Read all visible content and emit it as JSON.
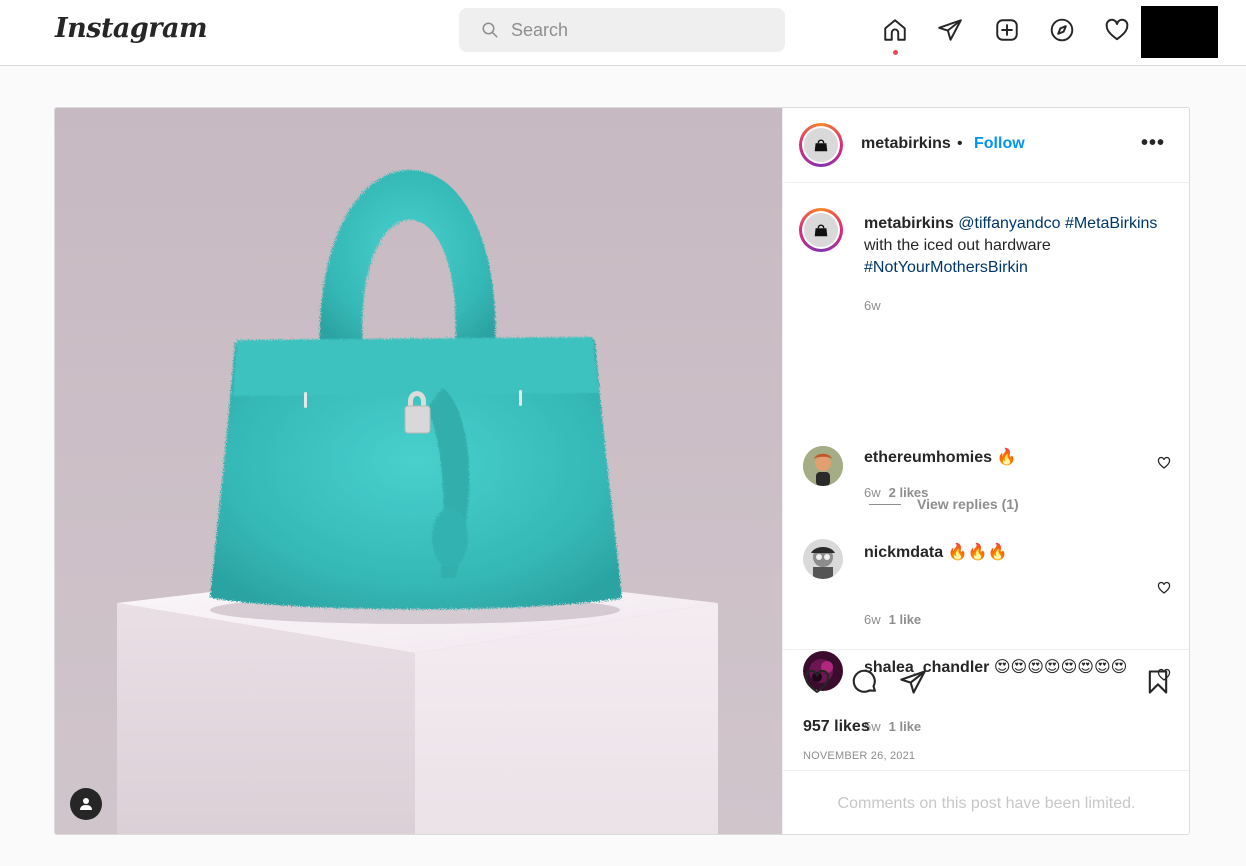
{
  "nav": {
    "logo": "Instagram",
    "search_placeholder": "Search",
    "icons": [
      "home-icon",
      "direct-icon",
      "new-post-icon",
      "explore-icon",
      "activity-icon"
    ]
  },
  "post": {
    "username": "metabirkins",
    "separator": "•",
    "follow_label": "Follow",
    "more_label": "•••",
    "caption": {
      "username": "metabirkins",
      "mention": "@tiffanyandco",
      "hashtag1": "#MetaBirkins",
      "text": "with the iced out hardware",
      "hashtag2": "#NotYourMothersBirkin",
      "time": "6w"
    },
    "comments": [
      {
        "username": "ethereumhomies",
        "text": "🔥",
        "time": "6w",
        "likes": "2 likes",
        "replies_label": "View replies (1)"
      },
      {
        "username": "nickmdata",
        "text": "🔥🔥🔥",
        "time": "6w",
        "likes": "1 like"
      },
      {
        "username": "shalea_chandler",
        "text": "😍😍😍😍😍😍😍😍",
        "time": "5w",
        "likes": "1 like"
      }
    ],
    "likes_count": "957 likes",
    "date": "NOVEMBER 26, 2021",
    "comments_limited": "Comments on this post have been limited."
  },
  "colors": {
    "accent": "#0095f6",
    "notification_dot": "#ed4956",
    "bag_teal": "#3fc4c2",
    "backdrop": "#cbbdc5"
  }
}
